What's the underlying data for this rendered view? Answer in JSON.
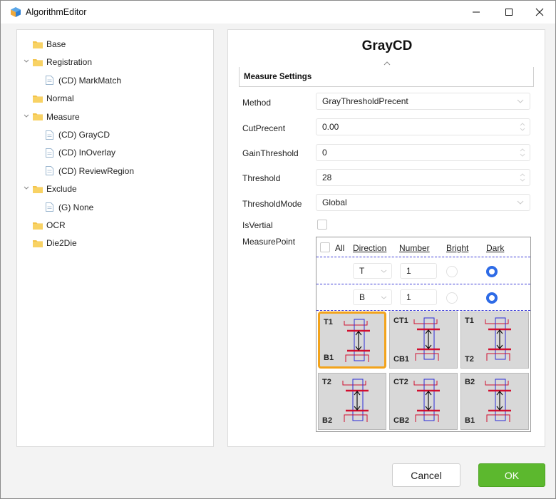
{
  "window": {
    "title": "AlgorithmEditor"
  },
  "tree": {
    "items": [
      {
        "label": "Base",
        "type": "folder",
        "expanded": false
      },
      {
        "label": "Registration",
        "type": "folder",
        "expanded": true
      },
      {
        "label": "(CD) MarkMatch",
        "type": "file"
      },
      {
        "label": "Normal",
        "type": "folder",
        "expanded": false
      },
      {
        "label": "Measure",
        "type": "folder",
        "expanded": true
      },
      {
        "label": "(CD) GrayCD",
        "type": "file"
      },
      {
        "label": "(CD) InOverlay",
        "type": "file"
      },
      {
        "label": "(CD) ReviewRegion",
        "type": "file"
      },
      {
        "label": "Exclude",
        "type": "folder",
        "expanded": true
      },
      {
        "label": "(G) None",
        "type": "file"
      },
      {
        "label": "OCR",
        "type": "folder",
        "expanded": false
      },
      {
        "label": "Die2Die",
        "type": "folder",
        "expanded": false
      }
    ]
  },
  "editor": {
    "title": "GrayCD",
    "section": "Measure Settings",
    "props": {
      "method": {
        "label": "Method",
        "value": "GrayThresholdPrecent"
      },
      "cutprecent": {
        "label": "CutPrecent",
        "value": "0.00"
      },
      "gainthreshold": {
        "label": "GainThreshold",
        "value": "0"
      },
      "threshold": {
        "label": "Threshold",
        "value": "28"
      },
      "thresholdmode": {
        "label": "ThresholdMode",
        "value": "Global"
      },
      "isvertial": {
        "label": "IsVertial",
        "checked": false
      },
      "measurepoint": {
        "label": "MeasurePoint"
      }
    },
    "measure_point": {
      "headers": {
        "all": "All",
        "direction": "Direction",
        "number": "Number",
        "bright": "Bright",
        "dark": "Dark"
      },
      "rows": [
        {
          "direction": "T",
          "number": "1",
          "selected": "Dark"
        },
        {
          "direction": "B",
          "number": "1",
          "selected": "Dark"
        }
      ],
      "tiles": [
        {
          "top": "T1",
          "bottom": "B1",
          "selected": true
        },
        {
          "top": "CT1",
          "bottom": "CB1",
          "selected": false
        },
        {
          "top": "T1",
          "bottom": "T2",
          "selected": false
        },
        {
          "top": "T2",
          "bottom": "B2",
          "selected": false
        },
        {
          "top": "CT2",
          "bottom": "CB2",
          "selected": false
        },
        {
          "top": "B2",
          "bottom": "B1",
          "selected": false
        }
      ]
    }
  },
  "buttons": {
    "cancel": "Cancel",
    "ok": "OK"
  },
  "colors": {
    "accent": "#2e6be6",
    "ok": "#5cb82e",
    "selection": "#f2a31c",
    "mark_red": "#d10f2f",
    "mark_blue": "#2b2bd8"
  }
}
